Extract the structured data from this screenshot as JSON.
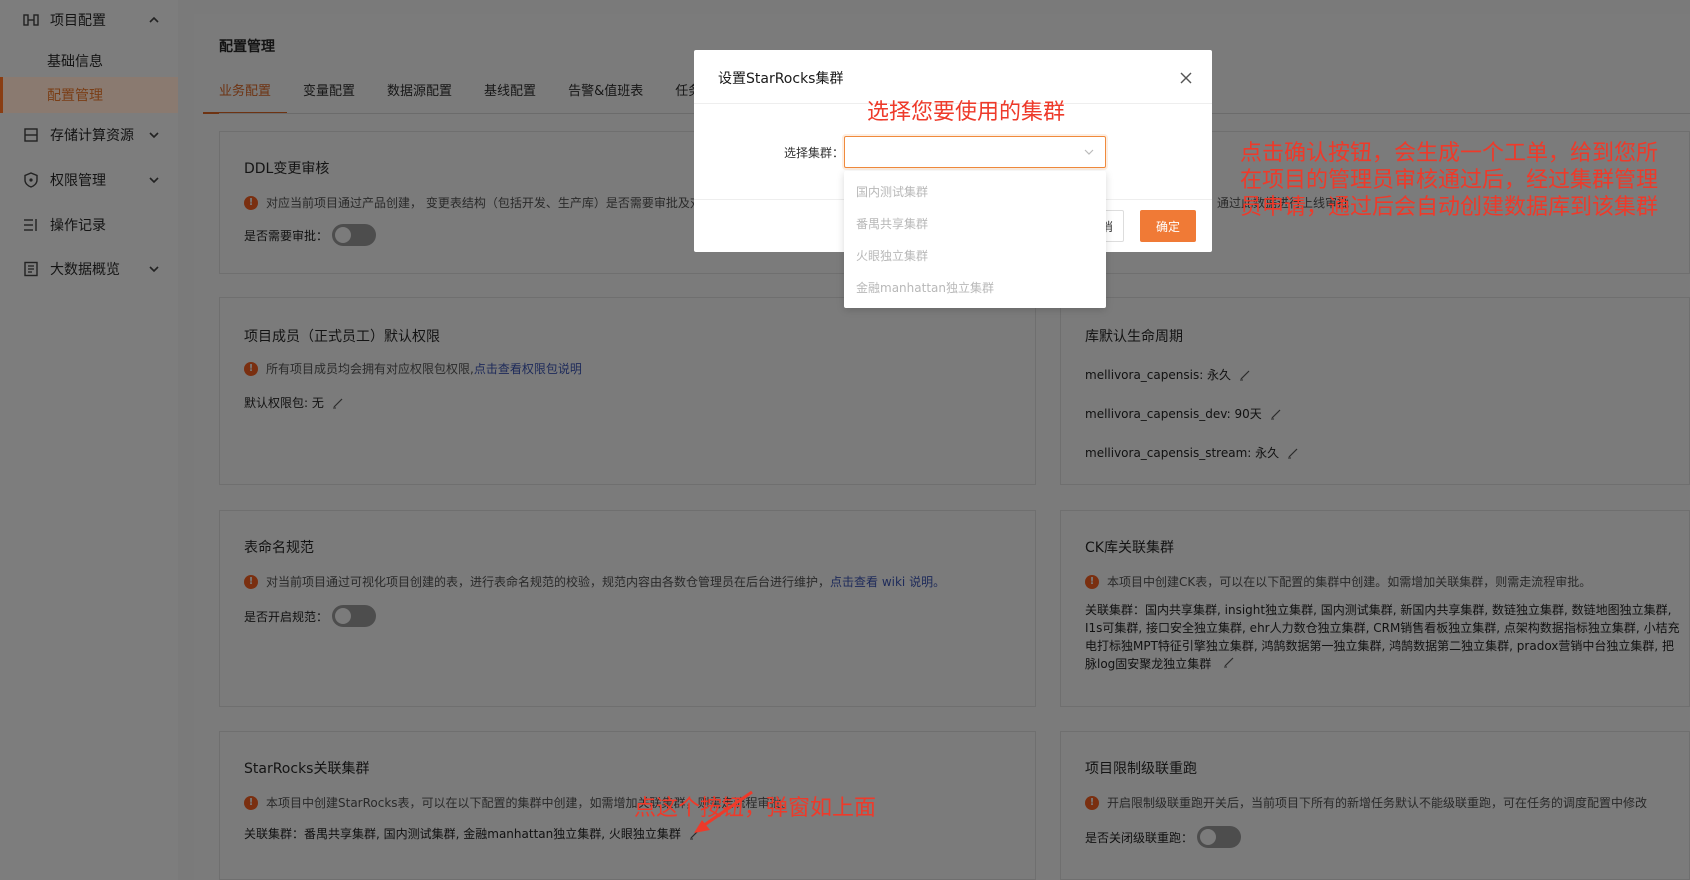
{
  "sidebar": {
    "groups": [
      {
        "label": "项目配置",
        "icon": "project-config-icon",
        "expanded": true
      },
      {
        "label": "存储计算资源",
        "icon": "storage-icon",
        "expanded": false
      },
      {
        "label": "权限管理",
        "icon": "permission-icon",
        "expanded": false
      },
      {
        "label": "操作记录",
        "icon": "log-icon"
      },
      {
        "label": "大数据概览",
        "icon": "overview-icon",
        "expanded": false
      }
    ],
    "sub_items": [
      {
        "label": "基础信息",
        "active": false
      },
      {
        "label": "配置管理",
        "active": true
      }
    ]
  },
  "page": {
    "title": "配置管理",
    "tabs": [
      "业务配置",
      "变量配置",
      "数据源配置",
      "基线配置",
      "告警&值班表",
      "任务上"
    ],
    "active_tab": "业务配置"
  },
  "cards": {
    "ddl": {
      "title": "DDL变更审核",
      "desc": "对应当前项目通过产品创建，  变更表结构（包括开发、生产库）是否需要审批及对",
      "desc_right": "通过此数据进行上线审批",
      "row_label": "是否需要审批："
    },
    "member": {
      "title": "项目成员（正式员工）默认权限",
      "desc": "所有项目成员均会拥有对应权限包权限,",
      "desc_link": "点击查看权限包说明",
      "row_label": "默认权限包: 无"
    },
    "lifecycle": {
      "title": "库默认生命周期",
      "rows": [
        "mellivora_capensis: 永久",
        "mellivora_capensis_dev: 90天",
        "mellivora_capensis_stream: 永久"
      ]
    },
    "naming": {
      "title": "表命名规范",
      "desc": "对当前项目通过可视化项目创建的表，进行表命名规范的校验，规范内容由各数仓管理员在后台进行维护，",
      "desc_link": "点击查看 wiki 说明。",
      "row_label": "是否开启规范："
    },
    "ck": {
      "title": "CK库关联集群",
      "desc": "本项目中创建CK表，可以在以下配置的集群中创建。如需增加关联集群，则需走流程审批。",
      "clusters": "关联集群：国内共享集群, insight独立集群, 国内测试集群, 新国内共享集群, 数链独立集群, 数链地图独立集群, I1s可集群, 接口安全独立集群, ehr人力数仓独立集群, CRM销售看板独立集群, 点架构数据指标独立集群, 小桔充电打标独MPT特征引擎独立集群, 鸿鹄数据第一独立集群, 鸿鹄数据第二独立集群, pradox营销中台独立集群, 把脉log固安聚龙独立集群"
    },
    "starrocks": {
      "title": "StarRocks关联集群",
      "desc": "本项目中创建StarRocks表，可以在以下配置的集群中创建，如需增加关联集群，则需走流程审批。",
      "row_label": "关联集群：番禺共享集群, 国内测试集群, 金融manhattan独立集群, 火眼独立集群"
    },
    "limit": {
      "title": "项目限制级联重跑",
      "desc": "开启限制级联重跑开关后，当前项目下所有的新增任务默认不能级联重跑，可在任务的调度配置中修改",
      "row_label": "是否关闭级联重跑："
    }
  },
  "modal": {
    "title": "设置StarRocks集群",
    "select_label": "选择集群：",
    "cancel_label": "消",
    "ok_label": "确定",
    "options": [
      "国内测试集群",
      "番禺共享集群",
      "火眼独立集群",
      "金融manhattan独立集群"
    ]
  },
  "annotations": {
    "top": "选择您要使用的集群",
    "right": "点击确认按钮，会生成一个工单，给到您所在项目的管理员审核通过后，经过集群管理员申请，通过后会自动创建数据库到该集群",
    "bottom": "点这个按钮，弹窗如上面",
    "color": "#ee3a2a"
  },
  "colors": {
    "accent": "#f07a36",
    "overlay": "#7a7a7a"
  }
}
